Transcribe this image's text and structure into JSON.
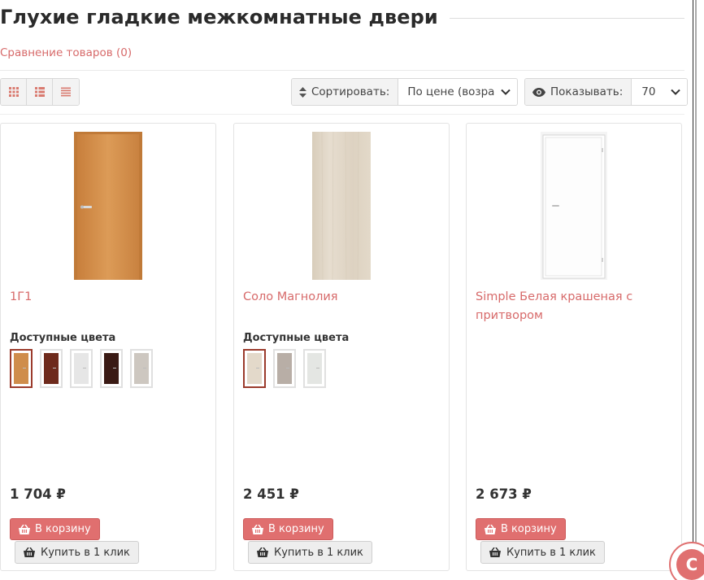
{
  "page": {
    "title": "Глухие гладкие межкомнатные двери",
    "compare_link": "Сравнение товаров (0)"
  },
  "toolbar": {
    "view_modes": [
      {
        "name": "grid",
        "icon": "grid-icon"
      },
      {
        "name": "list",
        "icon": "list-icon"
      },
      {
        "name": "compact",
        "icon": "compact-list-icon"
      }
    ],
    "sort_label": "Сортировать:",
    "sort_value": "По цене (возра",
    "show_label": "Показывать:",
    "show_value": "70"
  },
  "products": [
    {
      "name": "1Г1",
      "colors_label": "Доступные цвета",
      "price": "1 704 ₽",
      "cart_button": "В корзину",
      "oneclick_button": "Купить в 1 клик",
      "door_color": "#d4904a",
      "swatches": [
        "#cf8d4b",
        "#6e2a1c",
        "#e6e6e6",
        "#3a1a14",
        "#cdc7c0"
      ]
    },
    {
      "name": "Соло Магнолия",
      "colors_label": "Доступные цвета",
      "price": "2 451 ₽",
      "cart_button": "В корзину",
      "oneclick_button": "Купить в 1 клик",
      "door_color": "#e0d6c7",
      "swatches": [
        "#e3d9ca",
        "#b8aea6",
        "#e4e6e3"
      ]
    },
    {
      "name": "Simple Белая крашеная с притвором",
      "colors_label": "",
      "price": "2 673 ₽",
      "cart_button": "В корзину",
      "oneclick_button": "Купить в 1 клик",
      "door_color": "#ffffff",
      "swatches": []
    }
  ],
  "colors": {
    "accent": "#d76a6a",
    "button_primary": "#e06f6f",
    "button_secondary": "#eeeeee"
  }
}
